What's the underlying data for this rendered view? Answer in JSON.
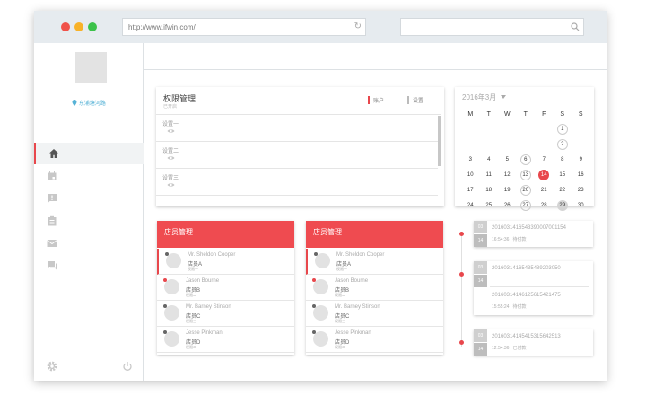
{
  "browser": {
    "url": "http://www.ifwin.com/"
  },
  "sidebar": {
    "location": "东浦塘河路"
  },
  "permissions": {
    "title": "权限管理",
    "subtitle": "已开启",
    "tabs": [
      {
        "label": "账户"
      },
      {
        "label": "设置"
      }
    ],
    "items": [
      {
        "label": "设置一"
      },
      {
        "label": "设置二"
      },
      {
        "label": "设置三"
      }
    ]
  },
  "calendar": {
    "month_label": "2016年3月",
    "weekdays": [
      "M",
      "T",
      "W",
      "T",
      "F",
      "S",
      "S"
    ],
    "days": [
      [
        "",
        "",
        "",
        "",
        "",
        "",
        "1"
      ],
      [
        "",
        "",
        "",
        "",
        "",
        "",
        "2"
      ],
      [
        "3",
        "4",
        "5",
        "6",
        "7",
        "8",
        "9"
      ],
      [
        "10",
        "11",
        "12",
        "13",
        "14",
        "15",
        "16"
      ],
      [
        "17",
        "18",
        "19",
        "20",
        "21",
        "22",
        "23"
      ],
      [
        "24",
        "25",
        "26",
        "27",
        "28",
        "29",
        "30"
      ]
    ],
    "ringed": [
      "1",
      "2",
      "6",
      "13",
      "20",
      "27"
    ],
    "today": "14",
    "selected": "29"
  },
  "staff_cards": [
    {
      "title": "店员管理",
      "employees": [
        {
          "name": "Mr. Sheldon Cooper",
          "role": "店员A",
          "sub": "权限一",
          "badge": "#666666"
        },
        {
          "name": "Jason Bourne",
          "role": "店员B",
          "sub": "权限二",
          "badge": "#e8474c"
        },
        {
          "name": "Mr. Barney Stinson",
          "role": "店员C",
          "sub": "权限三",
          "badge": "#666666"
        },
        {
          "name": "Jesse Pinkman",
          "role": "店员D",
          "sub": "权限二",
          "badge": "#666666"
        }
      ]
    },
    {
      "title": "店员管理",
      "employees": [
        {
          "name": "Mr. Sheldon Cooper",
          "role": "店员A",
          "sub": "权限一",
          "badge": "#666666"
        },
        {
          "name": "Jason Bourne",
          "role": "店员B",
          "sub": "权限二",
          "badge": "#e8474c"
        },
        {
          "name": "Mr. Barney Stinson",
          "role": "店员C",
          "sub": "权限三",
          "badge": "#666666"
        },
        {
          "name": "Jesse Pinkman",
          "role": "店员D",
          "sub": "权限二",
          "badge": "#666666"
        }
      ]
    }
  ],
  "timeline": [
    {
      "month": "03",
      "day": "14",
      "entries": [
        {
          "id": "2016031416543390007001154",
          "time": "16:54:36",
          "status": "待付款"
        }
      ]
    },
    {
      "month": "03",
      "day": "14",
      "entries": [
        {
          "id": "20160314165435489203050",
          "time": "",
          "status": ""
        },
        {
          "id": "20160314146125615421475",
          "time": "15:55:24",
          "status": "待付款"
        }
      ]
    },
    {
      "month": "03",
      "day": "14",
      "entries": [
        {
          "id": "20160314145415315642513",
          "time": "12:54:36",
          "status": "已付款"
        }
      ]
    }
  ],
  "colors": {
    "accent": "#ef4b50",
    "link": "#56b2d6"
  },
  "icons": [
    "home-icon",
    "calendar-icon",
    "alert-icon",
    "clipboard-icon",
    "mail-icon",
    "chat-icon",
    "settings-icon",
    "power-icon",
    "location-icon",
    "eye-icon",
    "search-icon",
    "reload-icon",
    "caret-down-icon"
  ]
}
